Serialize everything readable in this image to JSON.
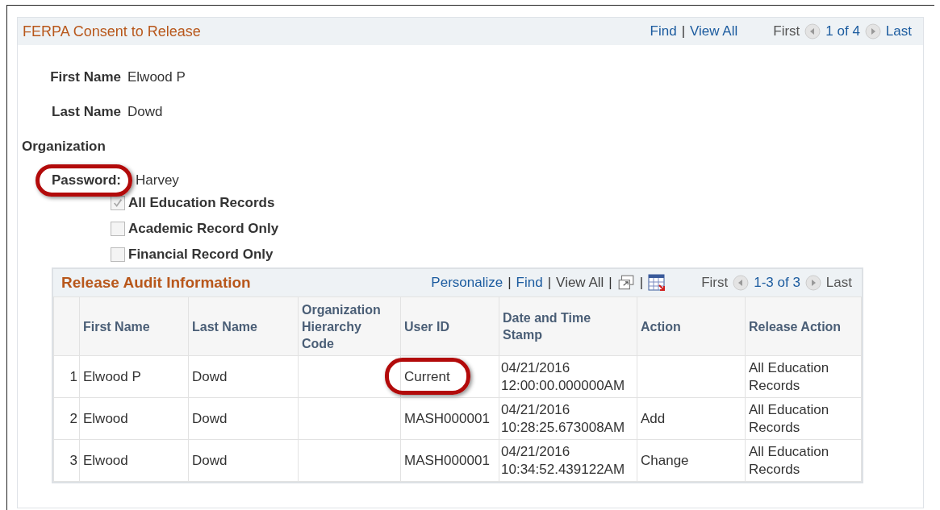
{
  "panel": {
    "title": "FERPA Consent to Release",
    "separator": "|",
    "links": [
      "Find",
      "View All"
    ],
    "nav": {
      "first": "First",
      "count": "1 of 4",
      "last": "Last"
    }
  },
  "fields": [
    {
      "label": "First Name",
      "value": "Elwood P"
    },
    {
      "label": "Last Name",
      "value": "Dowd"
    }
  ],
  "organization": {
    "label": "Organization"
  },
  "password": {
    "label": "Password:",
    "value": "Harvey",
    "highlighted": true
  },
  "checkboxes": [
    {
      "label": "All Education Records",
      "checked": true
    },
    {
      "label": "Academic Record Only",
      "checked": false
    },
    {
      "label": "Financial Record Only",
      "checked": false
    }
  ],
  "audit": {
    "title": "Release Audit Information",
    "separator": "|",
    "links": [
      "Personalize",
      "Find",
      "View All"
    ],
    "nav": {
      "first": "First",
      "count": "1-3 of 3",
      "last": "Last"
    },
    "columns": [
      "First Name",
      "Last Name",
      "Organization Hierarchy Code",
      "User ID",
      "Date and Time Stamp",
      "Action",
      "Release Action"
    ],
    "rows": [
      {
        "num": "1",
        "first": "Elwood P",
        "last": "Dowd",
        "org": "",
        "user": "Current",
        "user_highlighted": true,
        "date": "04/21/2016",
        "time": "12:00:00.000000AM",
        "action": "",
        "release": "All Education Records"
      },
      {
        "num": "2",
        "first": "Elwood",
        "last": "Dowd",
        "org": "",
        "user": "MASH000001",
        "user_highlighted": false,
        "date": "04/21/2016",
        "time": "10:28:25.673008AM",
        "action": "Add",
        "release": "All Education Records"
      },
      {
        "num": "3",
        "first": "Elwood",
        "last": "Dowd",
        "org": "",
        "user": "MASH000001",
        "user_highlighted": false,
        "date": "04/21/2016",
        "time": "10:34:52.439122AM",
        "action": "Change",
        "release": "All Education Records"
      }
    ]
  }
}
